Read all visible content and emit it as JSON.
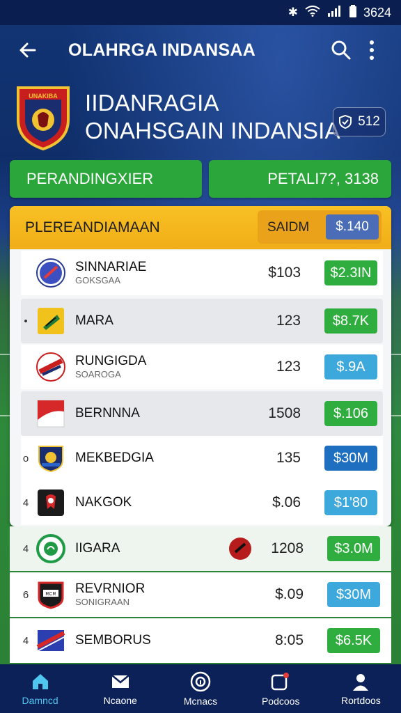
{
  "status_bar": {
    "time": "3624"
  },
  "app_bar": {
    "title": "OLAHRGA INDANSAA"
  },
  "club": {
    "name_line1": "IIDANRAGIA",
    "name_line2": "ONAHSGAIN INDANSIA",
    "crest_text": "UNAKIBA",
    "points": "512"
  },
  "buttons": {
    "left_label": "PERANDINGXIER",
    "right_label": "PETALI7?, 3138"
  },
  "table": {
    "header_label": "PLEREANDIAMAAN",
    "header_pill_label": "SAIDM",
    "header_pill_value": "$.140",
    "rows": [
      {
        "rank": "",
        "name": "SINNARIAE",
        "sub": "GOKSGAA",
        "num": "$103",
        "value": "$2.3IN",
        "value_color": "#2fae3f"
      },
      {
        "rank": "•",
        "name": "MARA",
        "sub": "",
        "num": "123",
        "value": "$8.7K",
        "value_color": "#2fae3f"
      },
      {
        "rank": "",
        "name": "RUNGIGDA",
        "sub": "SOAROGA",
        "num": "123",
        "value": "$.9A",
        "value_color": "#3da8dc"
      },
      {
        "rank": "",
        "name": "BERNNNA",
        "sub": "",
        "num": "1508",
        "value": "$.106",
        "value_color": "#2fae3f"
      },
      {
        "rank": "o",
        "name": "MEKBEDGIA",
        "sub": "",
        "num": "135",
        "value": "$30M",
        "value_color": "#1f6fc0"
      },
      {
        "rank": "4",
        "name": "NAKGOK",
        "sub": "",
        "num": "$.06",
        "value": "$1'80",
        "value_color": "#3da8dc"
      },
      {
        "rank": "4",
        "name": "IIGARA",
        "sub": "",
        "num": "1208",
        "value": "$3.0M",
        "value_color": "#2fae3f"
      },
      {
        "rank": "6",
        "name": "REVRNIOR",
        "sub": "SONIGRAAN",
        "num": "$.09",
        "value": "$30M",
        "value_color": "#3da8dc"
      },
      {
        "rank": "4",
        "name": "SEMBORUS",
        "sub": "",
        "num": "8:05",
        "value": "$6.5K",
        "value_color": "#2fae3f"
      }
    ]
  },
  "bottom_nav": [
    {
      "label": "Damncd",
      "icon": "home-icon",
      "active": true
    },
    {
      "label": "Ncaone",
      "icon": "mail-icon",
      "active": false
    },
    {
      "label": "Mcnacs",
      "icon": "target-icon",
      "active": false
    },
    {
      "label": "Podcoos",
      "icon": "notification-icon",
      "active": false
    },
    {
      "label": "Rortdoos",
      "icon": "profile-icon",
      "active": false
    }
  ]
}
